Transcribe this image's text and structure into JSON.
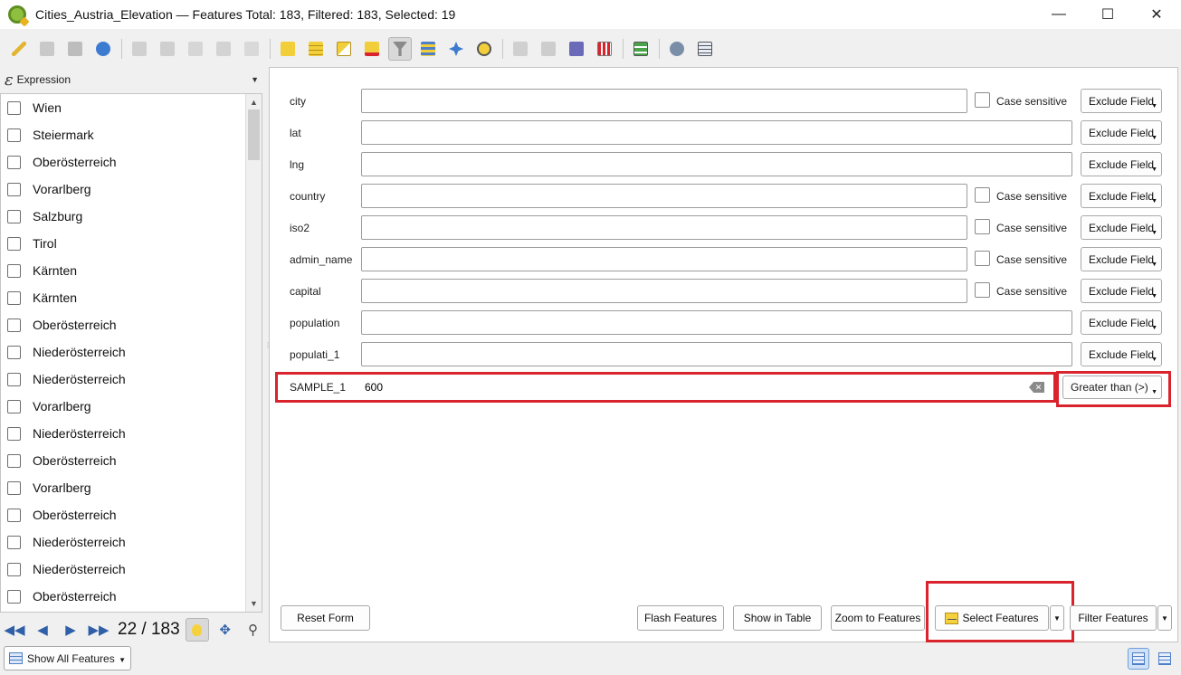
{
  "window": {
    "title": "Cities_Austria_Elevation — Features Total: 183, Filtered: 183, Selected: 19",
    "controls": [
      "minimize-icon",
      "maximize-icon",
      "close-icon"
    ]
  },
  "toolbar": {
    "icons": [
      "toggle-editing-icon",
      "multi-edit-icon",
      "save-edits-icon",
      "reload-icon",
      "add-feature-icon",
      "delete-feature-icon",
      "cut-icon",
      "copy-icon",
      "paste-icon",
      "select-by-expression-icon",
      "select-all-icon",
      "invert-selection-icon",
      "deselect-all-icon",
      "filter-form-icon",
      "move-selection-top-icon",
      "pan-to-selection-icon",
      "zoom-to-selection-icon",
      "new-field-icon",
      "delete-field-icon",
      "field-calculator-icon",
      "conditional-formatting-icon",
      "actions-icon",
      "dock-icon",
      "attribute-table-icon"
    ]
  },
  "left_panel": {
    "header_label": "Expression",
    "items": [
      "Wien",
      "Steiermark",
      "Oberösterreich",
      "Vorarlberg",
      "Salzburg",
      "Tirol",
      "Kärnten",
      "Kärnten",
      "Oberösterreich",
      "Niederösterreich",
      "Niederösterreich",
      "Vorarlberg",
      "Niederösterreich",
      "Oberösterreich",
      "Vorarlberg",
      "Oberösterreich",
      "Niederösterreich",
      "Niederösterreich",
      "Oberösterreich"
    ],
    "counter": "22 / 183"
  },
  "form": {
    "fields": [
      {
        "label": "city",
        "value": "",
        "case_sensitive": true
      },
      {
        "label": "lat",
        "value": "",
        "case_sensitive": false
      },
      {
        "label": "lng",
        "value": "",
        "case_sensitive": false
      },
      {
        "label": "country",
        "value": "",
        "case_sensitive": true
      },
      {
        "label": "iso2",
        "value": "",
        "case_sensitive": true
      },
      {
        "label": "admin_name",
        "value": "",
        "case_sensitive": true
      },
      {
        "label": "capital",
        "value": "",
        "case_sensitive": true
      },
      {
        "label": "population",
        "value": "",
        "case_sensitive": false
      },
      {
        "label": "populati_1",
        "value": "",
        "case_sensitive": false
      }
    ],
    "case_sensitive_label": "Case sensitive",
    "exclude_label": "Exclude Field",
    "sample": {
      "label": "SAMPLE_1",
      "value": "600",
      "operator_label": "Greater than (>)"
    },
    "buttons": {
      "reset": "Reset Form",
      "flash": "Flash Features",
      "show_in_table": "Show in Table",
      "zoom": "Zoom to Features",
      "select": "Select Features",
      "filter": "Filter Features"
    }
  },
  "bottom": {
    "show_all_label": "Show All Features"
  },
  "colors": {
    "highlight": "#d9232d",
    "nav_blue": "#2f5fa8"
  }
}
